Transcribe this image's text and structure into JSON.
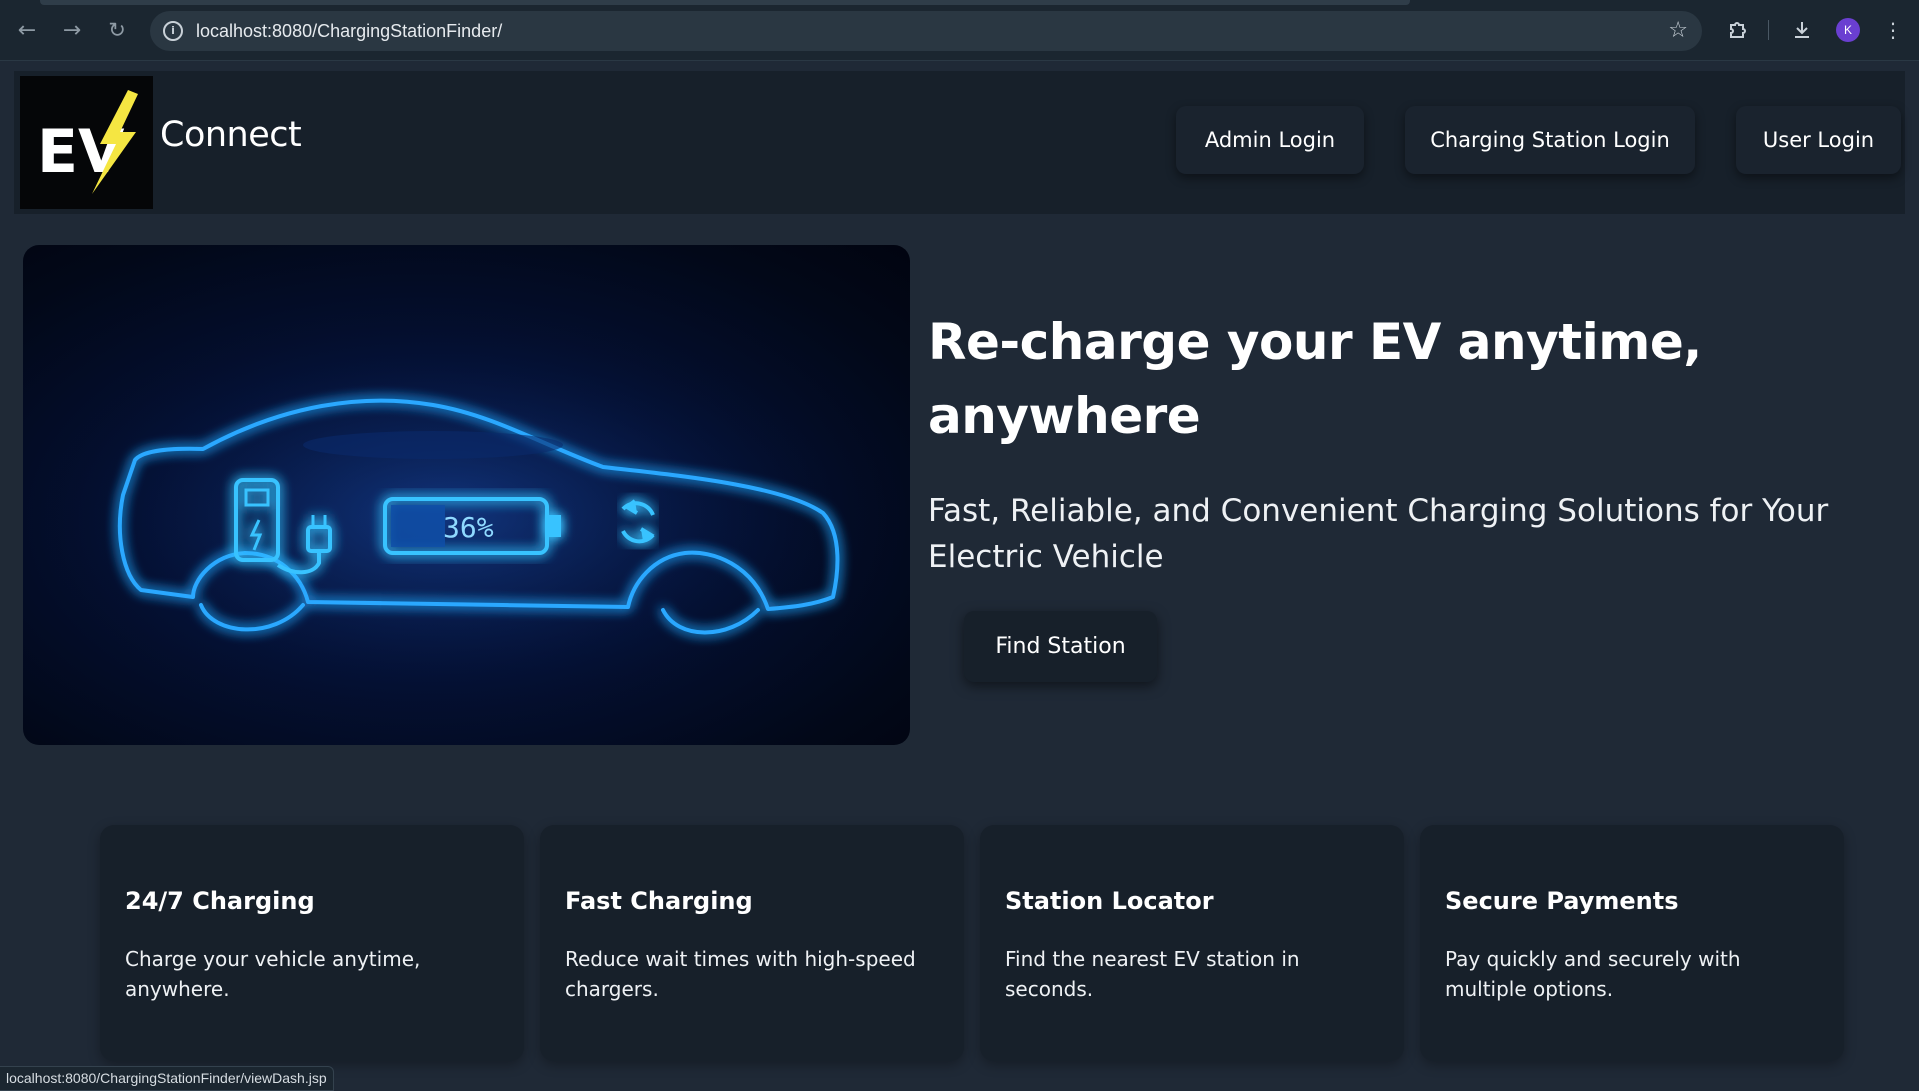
{
  "browser": {
    "url": "localhost:8080/ChargingStationFinder/",
    "profile_initial": "K",
    "status_url": "localhost:8080/ChargingStationFinder/viewDash.jsp"
  },
  "header": {
    "logo_text": "EV",
    "brand": "Connect",
    "nav": [
      {
        "label": "Admin Login"
      },
      {
        "label": "Charging Station Login"
      },
      {
        "label": "User Login"
      }
    ]
  },
  "hero": {
    "battery_text": "36%",
    "battery_level": 0.36,
    "title": "Re-charge your EV anytime, anywhere",
    "subtitle": "Fast, Reliable, and Convenient Charging Solutions for Your Electric Vehicle",
    "cta": "Find Station"
  },
  "features": [
    {
      "title": "24/7 Charging",
      "desc": "Charge your vehicle anytime, anywhere."
    },
    {
      "title": "Fast Charging",
      "desc": "Reduce wait times with high-speed chargers."
    },
    {
      "title": "Station Locator",
      "desc": "Find the nearest EV station in seconds."
    },
    {
      "title": "Secure Payments",
      "desc": "Pay quickly and securely with multiple options."
    }
  ],
  "colors": {
    "page_bg": "#1f2936",
    "header_bg": "#17202a",
    "neon": "#2aa8ff",
    "bolt": "#f5e642"
  }
}
